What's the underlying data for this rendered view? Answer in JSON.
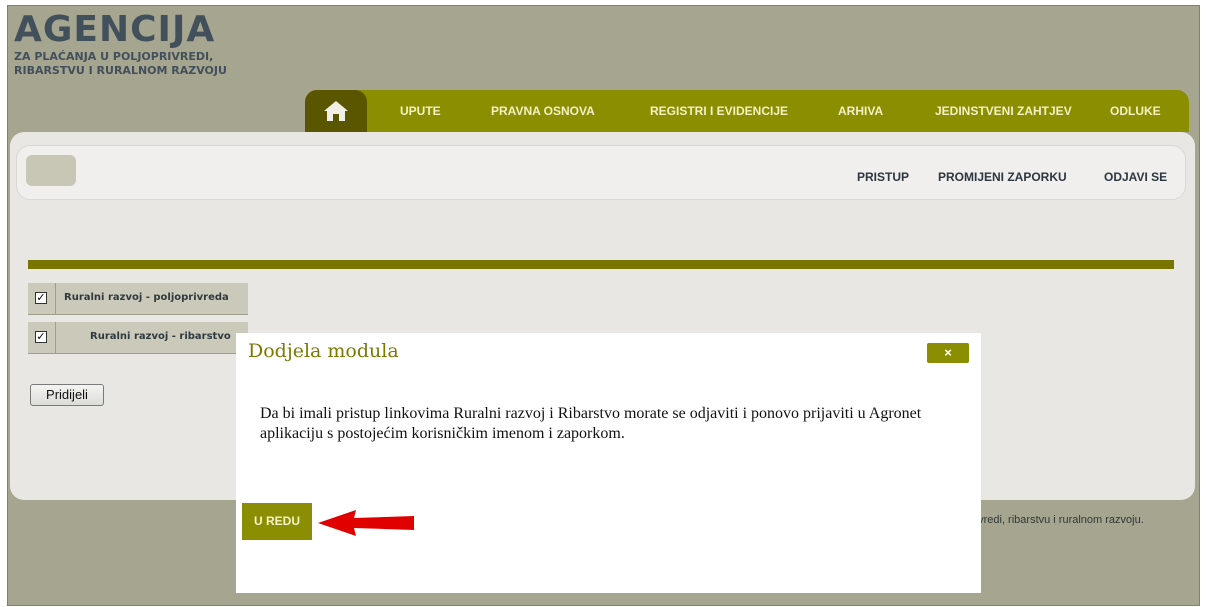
{
  "logo": {
    "title": "AGENCIJA",
    "subtitle": "ZA PLAĆANJA U POLJOPRIVREDI, RIBARSTVU I RURALNOM RAZVOJU"
  },
  "nav": {
    "items": [
      "UPUTE",
      "PRAVNA OSNOVA",
      "REGISTRI I EVIDENCIJE",
      "ARHIVA",
      "JEDINSTVENI ZAHTJEV",
      "ODLUKE"
    ]
  },
  "toplinks": [
    "PRISTUP",
    "PROMIJENI ZAPORKU",
    "ODJAVI SE"
  ],
  "modules": [
    {
      "label": "Ruralni razvoj - poljoprivreda",
      "checked": true
    },
    {
      "label": "Ruralni razvoj - ribarstvo",
      "checked": true
    }
  ],
  "assign_button": "Pridijeli",
  "footer": "rivredi, ribarstvu i ruralnom razvoju.",
  "modal": {
    "title": "Dodjela modula",
    "close": "×",
    "message": "Da bi imali pristup linkovima Ruralni razvoj i Ribarstvo morate se odjaviti i ponovo prijaviti u Agronet aplikaciju s postojećim korisničkim imenom i zaporkom.",
    "ok": "U REDU"
  },
  "colors": {
    "background": "#a6a58f",
    "olive": "#8b8e00",
    "dark_olive": "#5a5600",
    "arrow": "#e00000"
  },
  "icons": {
    "home": "home-icon",
    "check": "checkbox-check-icon",
    "arrow": "red-arrow-icon"
  }
}
